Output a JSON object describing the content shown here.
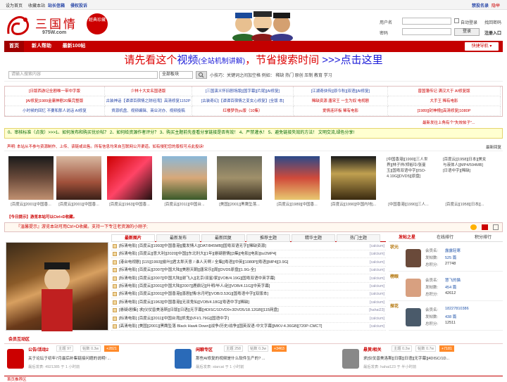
{
  "topbar": {
    "left": [
      "设为首页",
      "收藏本站",
      "站长信箱",
      "侵权投诉"
    ],
    "right": [
      "禁投名录",
      "隐举"
    ]
  },
  "logo": {
    "cn": "三国情",
    "url": "975W.com",
    "seal": "經典珍藏"
  },
  "login": {
    "user_label": "用户名",
    "pwd_label": "密码",
    "auto": "自动登录",
    "find": "找回密码",
    "login_btn": "登录",
    "register": "注册入口"
  },
  "nav": {
    "items": [
      "首页",
      "新人帮助",
      "最新100帖"
    ],
    "select": "快捷导航 ▾"
  },
  "banner": {
    "p1": "请先看这个",
    "p2": "视频",
    "p3": "(全站机制讲解)",
    "p4": "，节省搜索时间",
    "p5": " >>>点击这里"
  },
  "search": {
    "placeholder": "请输入搜索内容",
    "scope": "全部板块",
    "tip": "小技巧：关键词之间加空格  例如：  稀缺 热门 原创 压制 教育 学习"
  },
  "links": [
    [
      "[日版西游记全剧唯一带中字版",
      "少林十大女名国语版",
      "[三国演义怀旧剧场版][国字幕][片尾][AI修复]",
      "[江湖奇侠传][原今秋][双语][AI修复]",
      "曾国藩传记 满汉大于 AI修复版"
    ],
    [
      "[AI修复]1989金庸神剧20集完整版",
      "古装神话【谭谭百宿情之财经湾】高清修复1152P",
      "[古装奇幻]【谭谭百宿情之变女心修复】[全版 本]",
      "稀缺资源 唐宋王 一生为奴 电视剧",
      "大手王 稀有电影"
    ],
    [
      "小时候的回忆 不要和那人说话 AI修复",
      "貨源机盘、视频编辑、商业对办、视频投稿",
      "红楼梦伪yu版（10集）",
      "爱情连环板 稀有电影",
      "[1989][封神榜][高清修复]1080P"
    ]
  ],
  "rules": "0、审核标准（点我）>>>1、如何发布和购买优价帖？ 2、如何给资源作者评分？ 3、购买主题前先查看分享链接是否有效！ 4、严禁灌水！ 5、避免链接失效的方法！ 文明交流,绿色分享!",
  "notice": "声明: 本站从不参与资源制作、上传、该链或出售。所有信息均来自互联网公开渠道。如有侵犯您的版权可点此投诉!",
  "crumb": "三国情",
  "right_notice": "最新回复",
  "thumbs": [
    "[百度云][2001][中国香...",
    "[百度云][1963][中国香...",
    "[百度云][2011][中国台...",
    "[美国][2001][黑鹰坠落...",
    "[百度云][1989][中国香...",
    "[百度云][1990][中国内地]...",
    "[中国香港][1990][三人...",
    "[百度云][1958][日本][..."
  ],
  "thumb_text": [
    "[中国香港][1990][三人世界][林子祥/郑裕玲/张曼玉][国粤双语中字][ISO-4.19G][DVD5][原盘]",
    "[百度云][1958][日本][美女与液体人][MP4/594MB][日语中字][稀缺]"
  ],
  "kbd": "【今日提示】游览本站可以Ctrl+D收藏。",
  "bbar": "『温馨提示』游览本站可用Ctrl+D收藏。支持一下专注老资源的小刚子;",
  "tabs": [
    "最新图片",
    "最新发布",
    "最新回复",
    "推荐主题",
    "精华主题",
    "热门主题"
  ],
  "rows": [
    {
      "t": "[标清电影] [百度云][1993][中国香港][魔发情人][DAT/845MB][国粤双语无字][稀缺资源]",
      "u": "[calcium]"
    },
    {
      "t": "[标清电影] [百度云][意大利][2020][中国][东北刑大][1年][悬疑剧情][3集][电影][电影][ts/2MP4]",
      "u": "[calcium]"
    },
    {
      "t": "[港台电视剧] [115][1993][偷叶][君太郎天意 / 谁人天啊 / 全集][粤语][中英][1080P][粤语][MP4][3.9G]",
      "u": "[calcium]"
    },
    {
      "t": "[标清电影] [百度云][2007][中国大陆][美剧天朝][唐宋乐][周][DVD5原盘][1.9G-全]",
      "u": "[calcium]"
    },
    {
      "t": "[标清电影] [百度云][2007][中国大陆][谢飞入][北京/双星/家][VOB/4.19G][国粤双语中英字幕]",
      "u": "[calcium]"
    },
    {
      "t": "[标清电影] [百度云][2001][中国大陆][2007][鹿鼎记][叶明/毕人/赵][VOB/4.11G][中英字幕]",
      "u": "[calcium]"
    },
    {
      "t": "[标清电影] [百度云][2001][中国香港][喜剧][情/水月吧][VOB/3.53G][国粤语中字][双版本]",
      "u": "[calcium]"
    },
    {
      "t": "[标清电影] [百度云][1963][中国香港][无双鬼仙][VOB/4.18G][粤语中字][稀缺]",
      "u": "[calcium]"
    },
    {
      "t": "[悬疑/剧集] 求[仪仗兽美洛斯][日版][日语][无字幕][4DISC/1DVD9+3DVD5/18.12GB][115网盘]",
      "u": "[hahai23]"
    },
    {
      "t": "[标清电影] [百度云][2011][中国台湾][抓鬼][VFI/1.79G][国语中字]",
      "u": "[calcium]"
    },
    {
      "t": "[高清电影] [美国][2001][黑鹰坠落 Black Hawk Down][战争/历史/战争][国英双语-中文字幕][MKV-4.36GB][720P-CMCT]",
      "u": "[calcium]"
    }
  ],
  "rtabs": [
    "发帖之星",
    "在线排行",
    "积分排行"
  ],
  "rank": [
    {
      "lv": "状元",
      "name": "露露轻寒",
      "posts": "525 篇",
      "score": "27748"
    },
    {
      "lv": "榜眼",
      "name": "慧飞的猫",
      "posts": "454 篇",
      "score": "42612"
    },
    {
      "lv": "探花",
      "name": "18227810386",
      "posts": "438 篇",
      "score": "12511"
    }
  ],
  "rank_labels": {
    "name": "会员名:",
    "posts": "发帖数:",
    "score": "总积分:"
  },
  "community_title": "会员互动区",
  "cards": [
    {
      "n": "公告/活动2",
      "b1": "主题 97",
      "b2": "帖数 0.3w",
      "b3": "+2821",
      "tt": "关于论坛于初年7月最后补集链接问题的说明! ...",
      "mt": "最后发表: 4921385 于 1 小时前"
    },
    {
      "n": "闲聊专区",
      "b1": "主题 258",
      "b2": "帖数 0.3w",
      "b3": "+3463",
      "tt": "那些AI修复的视频是什么软件生产的? ...",
      "mt": "最后发表: starcat 于 1 小时前"
    },
    {
      "n": "悬赏/相关",
      "b1": "主题 0.2w",
      "b2": "帖数 0.7w",
      "b3": "+7181",
      "tt": "求[仪仗兽美洛斯][日版][日语][无字幕][4DISC/1D...",
      "mt": "最后发表: hahai123 于 半小时前"
    }
  ],
  "footer": "首页推荐区"
}
